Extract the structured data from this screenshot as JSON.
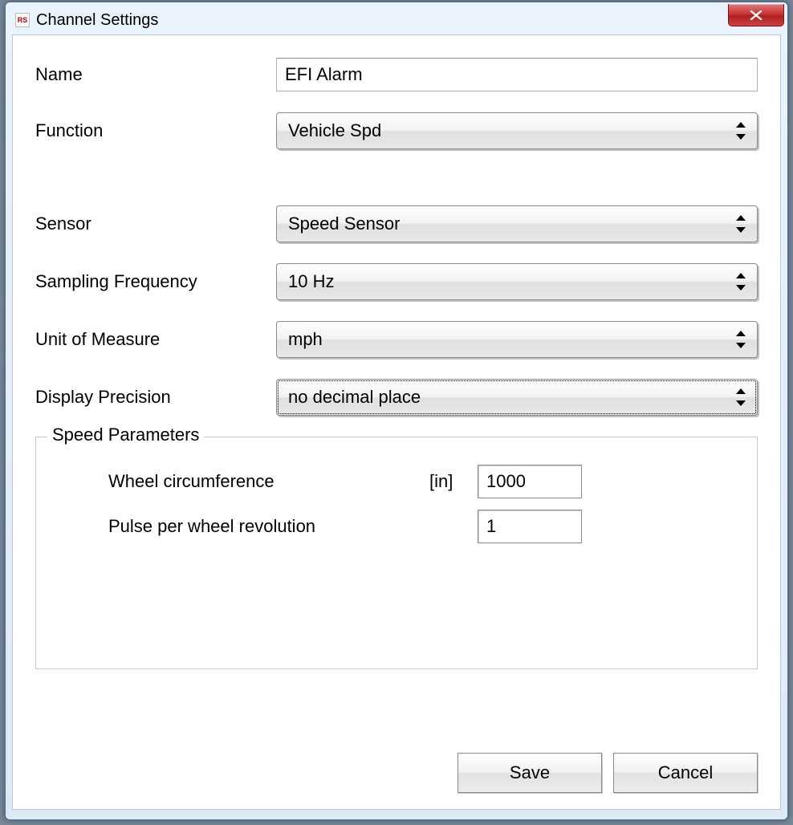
{
  "window": {
    "title": "Channel Settings",
    "icon_text": "RS"
  },
  "form": {
    "name_label": "Name",
    "name_value": "EFI Alarm",
    "function_label": "Function",
    "function_value": "Vehicle Spd",
    "sensor_label": "Sensor",
    "sensor_value": "Speed Sensor",
    "sampling_label": "Sampling Frequency",
    "sampling_value": "10 Hz",
    "uom_label": "Unit of Measure",
    "uom_value": "mph",
    "precision_label": "Display Precision",
    "precision_value": "no decimal place"
  },
  "speed_params": {
    "group_title": "Speed Parameters",
    "wheel_label": "Wheel circumference",
    "wheel_unit": "[in]",
    "wheel_value": "1000",
    "pulse_label": "Pulse per wheel revolution",
    "pulse_value": "1"
  },
  "buttons": {
    "save": "Save",
    "cancel": "Cancel"
  }
}
